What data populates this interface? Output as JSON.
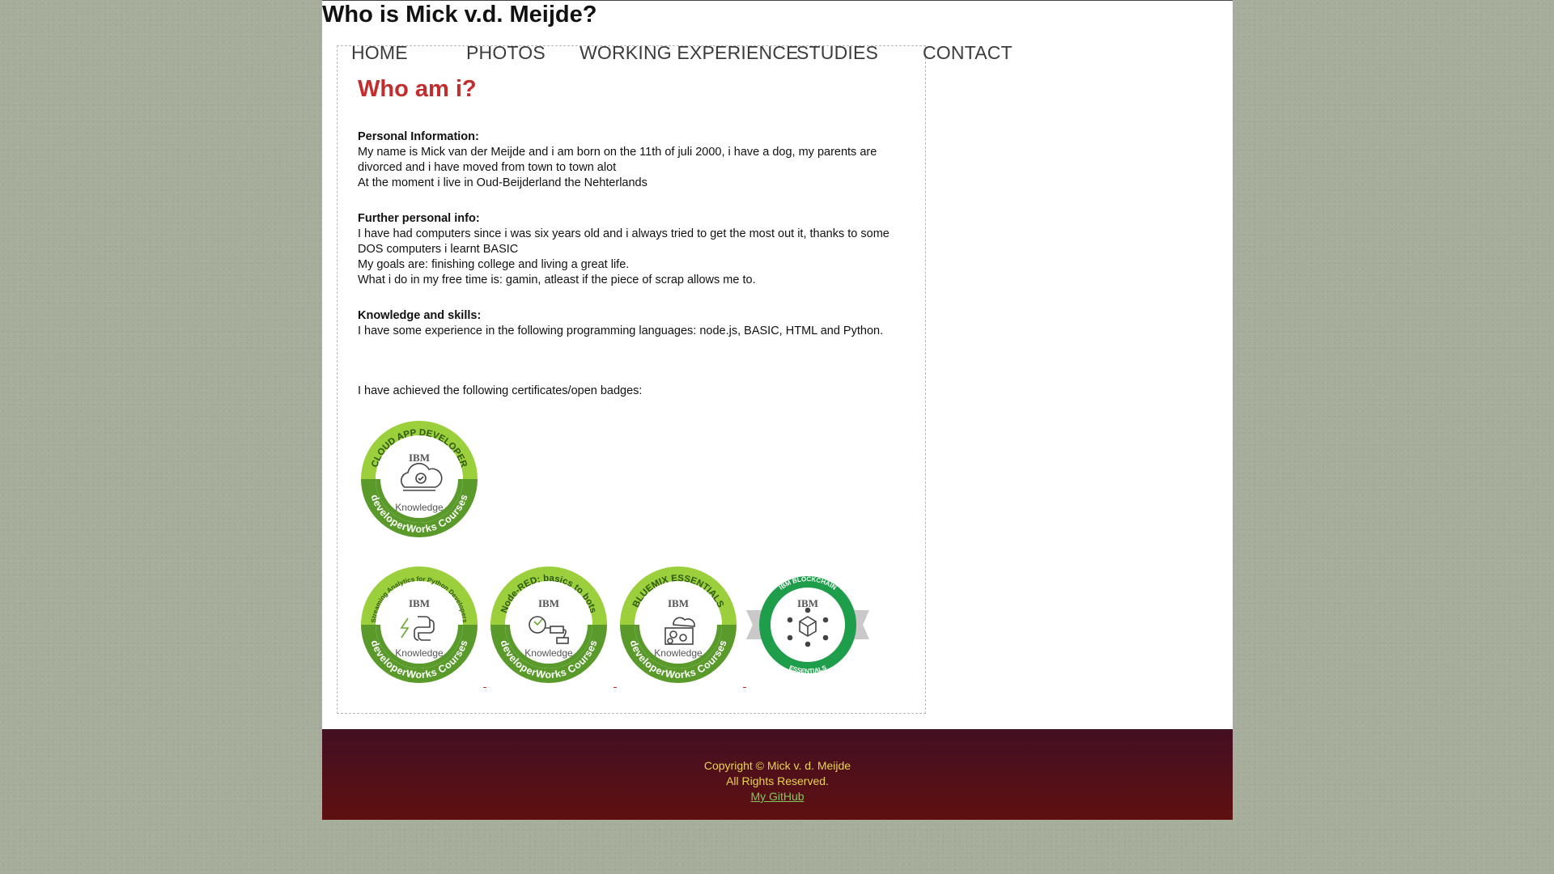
{
  "site": {
    "title": "Who is Mick v.d. Meijde?"
  },
  "nav": {
    "items": [
      {
        "label": "HOME"
      },
      {
        "label": "PHOTOS"
      },
      {
        "label": "WORKING EXPERIENCE"
      },
      {
        "label": "STUDIES"
      },
      {
        "label": "CONTACT"
      }
    ]
  },
  "main": {
    "heading": "Who am i?",
    "sections": [
      {
        "title": "Personal Information:",
        "lines": [
          "My name is Mick van der Meijde and i am born on the 11th of juli 2000, i have a dog, my parents are divorced and i have moved from town to town alot",
          "At the moment i live in Oud-Beijderland the Nehterlands"
        ]
      },
      {
        "title": "Further personal info:",
        "lines": [
          "I have had computers since i was six years old and i always tried to get the most out it, thanks to some DOS computers i learnt BASIC",
          "My goals are: finishing college and living a great life.",
          "What i do in my free time is: gamin, atleast if the piece of scrap allows me to."
        ]
      },
      {
        "title": "Knowledge and skills:",
        "lines": [
          "I have some experience in the following programming languages: node.js, BASIC, HTML and Python."
        ]
      }
    ],
    "badges_intro": "I have achieved the following certificates/open badges:",
    "badges": [
      {
        "ring_text": "CLOUD APP DEVELOPER",
        "bottom_text": "developerWorks Courses",
        "brand": "IBM",
        "level": "Knowledge",
        "icon": "cloud-icon",
        "color": "#5a9a2a",
        "light": "#9ccf3c"
      },
      {
        "ring_text": "Streaming Analytics for Python Developers",
        "bottom_text": "developerWorks Courses",
        "brand": "IBM",
        "level": "Knowledge",
        "icon": "python-streaming-icon",
        "color": "#5a9a2a",
        "light": "#9ccf3c"
      },
      {
        "ring_text": "Node-RED: basics to bots",
        "bottom_text": "developerWorks Courses",
        "brand": "IBM",
        "level": "Knowledge",
        "icon": "node-red-icon",
        "color": "#5a9a2a",
        "light": "#9ccf3c"
      },
      {
        "ring_text": "BLUEMIX ESSENTIALS",
        "bottom_text": "developerWorks Courses",
        "brand": "IBM",
        "level": "Knowledge",
        "icon": "bluemix-icon",
        "color": "#5a9a2a",
        "light": "#9ccf3c"
      },
      {
        "ring_text": "IBM BLOCKCHAIN",
        "bottom_text": "ESSENTIALS",
        "brand": "IBM",
        "level": "",
        "icon": "blockchain-icon",
        "color": "#1e9e4a",
        "light": "#1e9e4a"
      }
    ]
  },
  "footer": {
    "copyright": "Copyright © Mick v. d. Meijde",
    "rights": "All Rights Reserved.",
    "github_label": "My GitHub"
  }
}
